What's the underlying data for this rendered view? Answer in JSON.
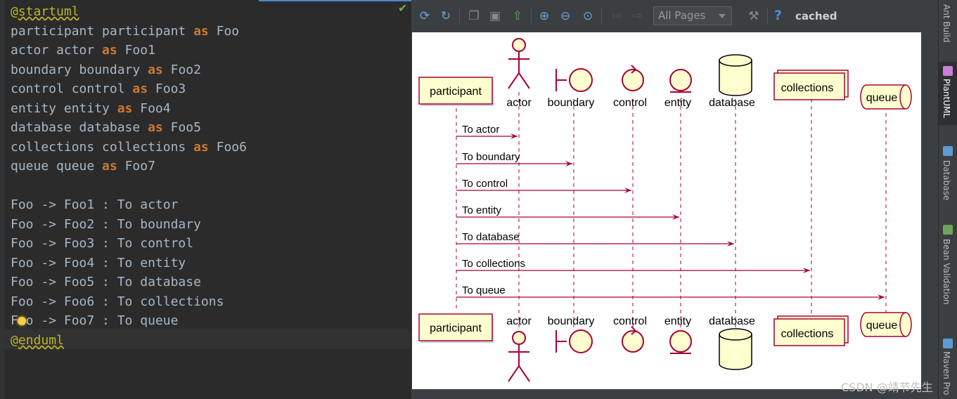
{
  "editor": {
    "lines": [
      {
        "parts": [
          {
            "t": "@",
            "c": "at"
          },
          {
            "t": "startuml",
            "c": "meta-name"
          }
        ]
      },
      {
        "parts": [
          {
            "t": "participant participant ",
            "c": ""
          },
          {
            "t": "as",
            "c": "kw"
          },
          {
            "t": " Foo",
            "c": ""
          }
        ]
      },
      {
        "parts": [
          {
            "t": "actor actor ",
            "c": ""
          },
          {
            "t": "as",
            "c": "kw"
          },
          {
            "t": " Foo1",
            "c": ""
          }
        ]
      },
      {
        "parts": [
          {
            "t": "boundary boundary ",
            "c": ""
          },
          {
            "t": "as",
            "c": "kw"
          },
          {
            "t": " Foo2",
            "c": ""
          }
        ]
      },
      {
        "parts": [
          {
            "t": "control control ",
            "c": ""
          },
          {
            "t": "as",
            "c": "kw"
          },
          {
            "t": " Foo3",
            "c": ""
          }
        ]
      },
      {
        "parts": [
          {
            "t": "entity entity ",
            "c": ""
          },
          {
            "t": "as",
            "c": "kw"
          },
          {
            "t": " Foo4",
            "c": ""
          }
        ]
      },
      {
        "parts": [
          {
            "t": "database database ",
            "c": ""
          },
          {
            "t": "as",
            "c": "kw"
          },
          {
            "t": " Foo5",
            "c": ""
          }
        ]
      },
      {
        "parts": [
          {
            "t": "collections collections ",
            "c": ""
          },
          {
            "t": "as",
            "c": "kw"
          },
          {
            "t": " Foo6",
            "c": ""
          }
        ]
      },
      {
        "parts": [
          {
            "t": "queue queue ",
            "c": ""
          },
          {
            "t": "as",
            "c": "kw"
          },
          {
            "t": " Foo7",
            "c": ""
          }
        ]
      },
      {
        "parts": []
      },
      {
        "parts": [
          {
            "t": "Foo -> Foo1 : To actor",
            "c": ""
          }
        ]
      },
      {
        "parts": [
          {
            "t": "Foo -> Foo2 : To boundary",
            "c": ""
          }
        ]
      },
      {
        "parts": [
          {
            "t": "Foo -> Foo3 : To control",
            "c": ""
          }
        ]
      },
      {
        "parts": [
          {
            "t": "Foo -> Foo4 : To entity",
            "c": ""
          }
        ]
      },
      {
        "parts": [
          {
            "t": "Foo -> Foo5 : To database",
            "c": ""
          }
        ]
      },
      {
        "parts": [
          {
            "t": "Foo -> Foo6 : To collections",
            "c": ""
          }
        ]
      },
      {
        "parts": [
          {
            "t": "Foo -> Foo7 : To queue",
            "c": ""
          }
        ]
      },
      {
        "parts": [
          {
            "t": "@",
            "c": "at"
          },
          {
            "t": "enduml",
            "c": "meta-name"
          }
        ]
      }
    ]
  },
  "toolbar": {
    "pages_select": "All Pages",
    "cached_label": "cached",
    "help_glyph": "?"
  },
  "diagram": {
    "participants": [
      {
        "kind": "participant",
        "label": "participant"
      },
      {
        "kind": "actor",
        "label": "actor"
      },
      {
        "kind": "boundary",
        "label": "boundary"
      },
      {
        "kind": "control",
        "label": "control"
      },
      {
        "kind": "entity",
        "label": "entity"
      },
      {
        "kind": "database",
        "label": "database"
      },
      {
        "kind": "collections",
        "label": "collections"
      },
      {
        "kind": "queue",
        "label": "queue"
      }
    ],
    "messages": [
      {
        "from": 0,
        "to": 1,
        "label": "To actor"
      },
      {
        "from": 0,
        "to": 2,
        "label": "To boundary"
      },
      {
        "from": 0,
        "to": 3,
        "label": "To control"
      },
      {
        "from": 0,
        "to": 4,
        "label": "To entity"
      },
      {
        "from": 0,
        "to": 5,
        "label": "To database"
      },
      {
        "from": 0,
        "to": 6,
        "label": "To collections"
      },
      {
        "from": 0,
        "to": 7,
        "label": "To queue"
      }
    ],
    "colors": {
      "fill": "#fefece",
      "border": "#a80036",
      "line": "#a80036",
      "text": "#000000"
    }
  },
  "right_tools": [
    {
      "label": "Ant Build",
      "active": false
    },
    {
      "label": "PlantUML",
      "active": true
    },
    {
      "label": "Database",
      "active": false
    },
    {
      "label": "Bean Validation",
      "active": false
    },
    {
      "label": "Maven Pro",
      "active": false
    }
  ],
  "watermark": "CSDN @靖节先生"
}
